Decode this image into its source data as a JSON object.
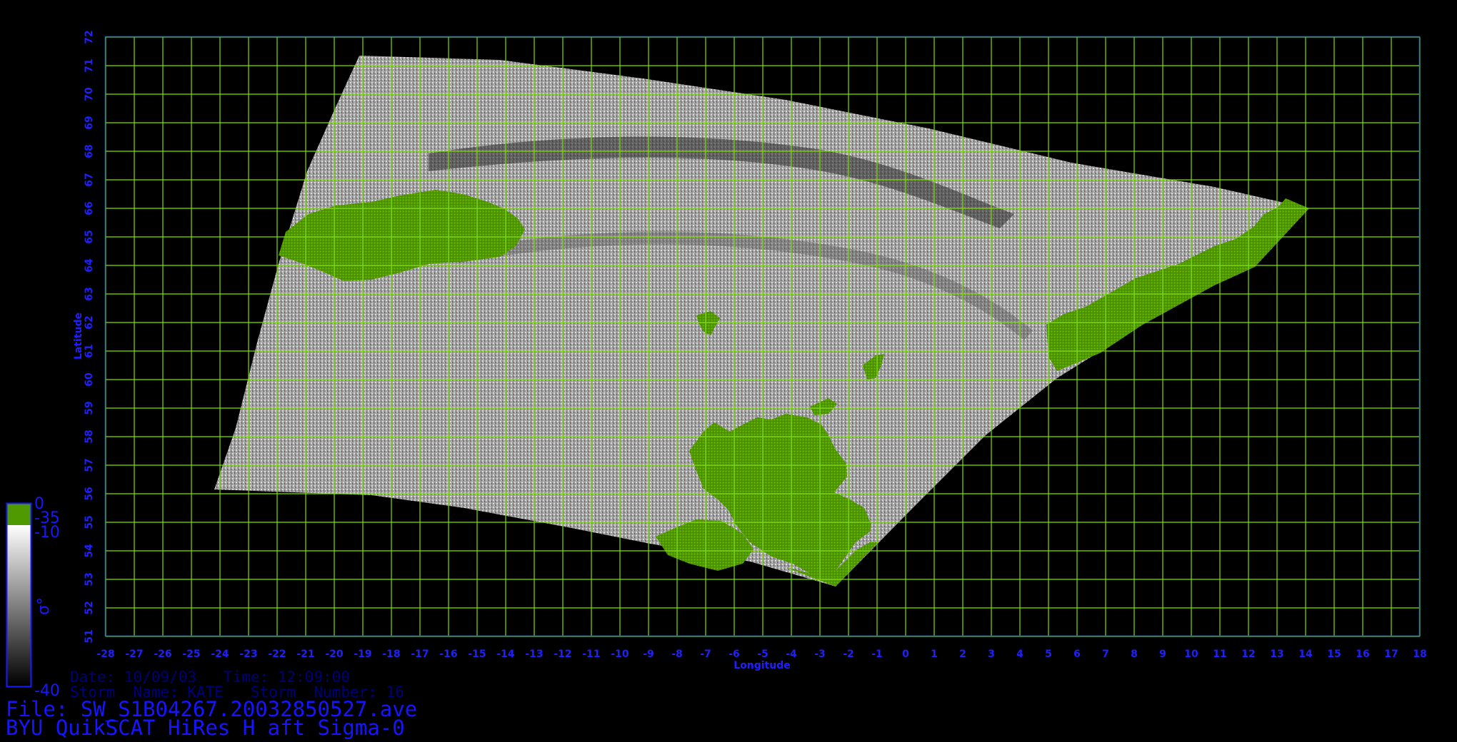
{
  "map": {
    "x_axis_label": "Longitude",
    "y_axis_label": "Latitude",
    "lon_ticks": [
      "-28",
      "-27",
      "-26",
      "-25",
      "-24",
      "-23",
      "-22",
      "-21",
      "-20",
      "-19",
      "-18",
      "-17",
      "-16",
      "-15",
      "-14",
      "-13",
      "-12",
      "-11",
      "-10",
      "-9",
      "-8",
      "-7",
      "-6",
      "-5",
      "-4",
      "-3",
      "-2",
      "-1",
      "0",
      "1",
      "2",
      "3",
      "4",
      "5",
      "6",
      "7",
      "8",
      "9",
      "10",
      "11",
      "12",
      "13",
      "14",
      "15",
      "16",
      "17",
      "18"
    ],
    "lat_ticks": [
      "51",
      "52",
      "53",
      "54",
      "55",
      "56",
      "57",
      "58",
      "59",
      "60",
      "61",
      "62",
      "63",
      "64",
      "65",
      "66",
      "67",
      "68",
      "69",
      "70",
      "71",
      "72"
    ],
    "lon_range": [
      -28,
      18
    ],
    "lat_range": [
      51,
      72
    ],
    "grid": true,
    "colors": {
      "background": "#000000",
      "grid": "#7ee000",
      "axis": "#2a6cff",
      "land": "#4f9a00",
      "labels": "#2020ff"
    }
  },
  "colorbar": {
    "labels": [
      "0",
      "-35",
      "-10",
      "-40"
    ],
    "symbol": "σ°"
  },
  "info": {
    "date_line": "Date: 10/09/03   Time: 12:09:00",
    "storm_line": "Storm  Name: KATE   Storm  Number: 16",
    "file_line": "File: SW_S1B04267.20032850527.ave",
    "product_line": "BYU QuikSCAT HiRes H aft Sigma-0"
  }
}
